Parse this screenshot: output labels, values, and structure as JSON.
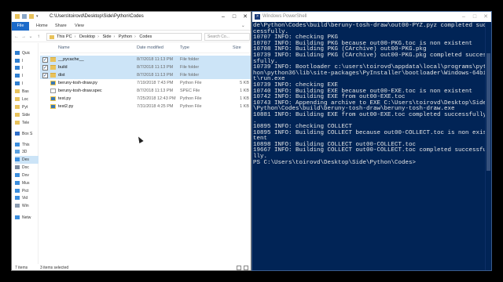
{
  "explorer": {
    "path_text": "C:\\Users\\toirovd\\Desktop\\Side\\Python\\Codes",
    "ribbon_tabs": [
      "File",
      "Home",
      "Share",
      "View"
    ],
    "breadcrumbs": [
      "This PC",
      "Desktop",
      "Side",
      "Python",
      "Codes"
    ],
    "search_placeholder": "Search Co...",
    "columns": {
      "name": "Name",
      "date": "Date modified",
      "type": "Type",
      "size": "Size"
    },
    "nav_items": [
      {
        "label": "Quic",
        "icon": "star-icon",
        "color": "#2f7fd1"
      },
      {
        "label": "I",
        "icon": "pin-icon",
        "color": "#2f7fd1"
      },
      {
        "label": "I",
        "icon": "pin-icon",
        "color": "#2f7fd1"
      },
      {
        "label": "I",
        "icon": "pin-icon",
        "color": "#2f7fd1"
      },
      {
        "label": "I",
        "icon": "pin-icon",
        "color": "#2f7fd1"
      },
      {
        "label": "Bas",
        "icon": "folder-icon",
        "color": "#e8c25b"
      },
      {
        "label": "Loc",
        "icon": "folder-icon",
        "color": "#e8c25b"
      },
      {
        "label": "Pyt",
        "icon": "folder-icon",
        "color": "#e8c25b"
      },
      {
        "label": "Side",
        "icon": "folder-icon",
        "color": "#e8c25b"
      },
      {
        "label": "Tele",
        "icon": "folder-icon",
        "color": "#e8c25b"
      },
      {
        "label": "Box S",
        "icon": "box-icon",
        "color": "#2f6fc9"
      },
      {
        "label": "This",
        "icon": "pc-icon",
        "color": "#3b8ede"
      },
      {
        "label": "3D",
        "icon": "cube-icon",
        "color": "#5aa0e0"
      },
      {
        "label": "Des",
        "icon": "desktop-icon",
        "color": "#3b8ede"
      },
      {
        "label": "Doc",
        "icon": "document-icon",
        "color": "#7a8aa0"
      },
      {
        "label": "Dov",
        "icon": "download-icon",
        "color": "#3b8ede"
      },
      {
        "label": "Mus",
        "icon": "music-icon",
        "color": "#3b8ede"
      },
      {
        "label": "Pict",
        "icon": "picture-icon",
        "color": "#3b8ede"
      },
      {
        "label": "Vid",
        "icon": "video-icon",
        "color": "#3b8ede"
      },
      {
        "label": "Win",
        "icon": "drive-icon",
        "color": "#8a9bb0"
      },
      {
        "label": "Netw",
        "icon": "network-icon",
        "color": "#3b8ede"
      }
    ],
    "files": [
      {
        "name": "__pycache__",
        "date": "8/7/2018 11:13 PM",
        "type": "File folder",
        "size": "",
        "kind": "folder",
        "selected": true,
        "checked": true
      },
      {
        "name": "build",
        "date": "8/7/2018 11:13 PM",
        "type": "File folder",
        "size": "",
        "kind": "folder",
        "selected": true,
        "checked": true
      },
      {
        "name": "dist",
        "date": "8/7/2018 11:13 PM",
        "type": "File folder",
        "size": "",
        "kind": "folder",
        "selected": true,
        "checked": true
      },
      {
        "name": "beruny-tosh-draw.py",
        "date": "7/19/2018 7:43 PM",
        "type": "Python File",
        "size": "5 KB",
        "kind": "py",
        "selected": false,
        "checked": false
      },
      {
        "name": "beruny-tosh-draw.spec",
        "date": "8/7/2018 11:13 PM",
        "type": "SPEC File",
        "size": "1 KB",
        "kind": "spec",
        "selected": false,
        "checked": false
      },
      {
        "name": "test.py",
        "date": "7/25/2018 12:43 PM",
        "type": "Python File",
        "size": "1 KB",
        "kind": "py",
        "selected": false,
        "checked": false
      },
      {
        "name": "test2.py",
        "date": "7/31/2018 4:25 PM",
        "type": "Python File",
        "size": "1 KB",
        "kind": "py",
        "selected": false,
        "checked": false
      }
    ],
    "status_count": "7 items",
    "status_selected": "3 items selected"
  },
  "powershell": {
    "title": "Windows PowerShell",
    "lines": [
      "de\\Python\\Codes\\build\\beruny-tosh-draw\\out00-PYZ.pyz completed suc",
      "cessfully.",
      "10707 INFO: checking PKG",
      "10707 INFO: Building PKG because out00-PKG.toc is non existent",
      "10708 INFO: Building PKG (CArchive) out00-PKG.pkg",
      "10739 INFO: Building PKG (CArchive) out00-PKG.pkg completed succes",
      "sfully.",
      "10739 INFO: Bootloader c:\\users\\toirovd\\appdata\\local\\programs\\pyt",
      "hon\\python36\\lib\\site-packages\\PyInstaller\\bootloader\\Windows-64bi",
      "t\\run.exe",
      "10739 INFO: checking EXE",
      "10740 INFO: Building EXE because out00-EXE.toc is non existent",
      "10742 INFO: Building EXE from out00-EXE.toc",
      "10743 INFO: Appending archive to EXE C:\\Users\\toirovd\\Desktop\\Side",
      "\\Python\\Codes\\build\\beruny-tosh-draw\\beruny-tosh-draw.exe",
      "10881 INFO: Building EXE from out00-EXE.toc completed successfully",
      ".",
      "10895 INFO: checking COLLECT",
      "10895 INFO: Building COLLECT because out00-COLLECT.toc is non exis",
      "tent",
      "10898 INFO: Building COLLECT out00-COLLECT.toc",
      "19667 INFO: Building COLLECT out00-COLLECT.toc completed successfu",
      "lly.",
      "PS C:\\Users\\toirovd\\Desktop\\Side\\Python\\Codes>"
    ]
  }
}
